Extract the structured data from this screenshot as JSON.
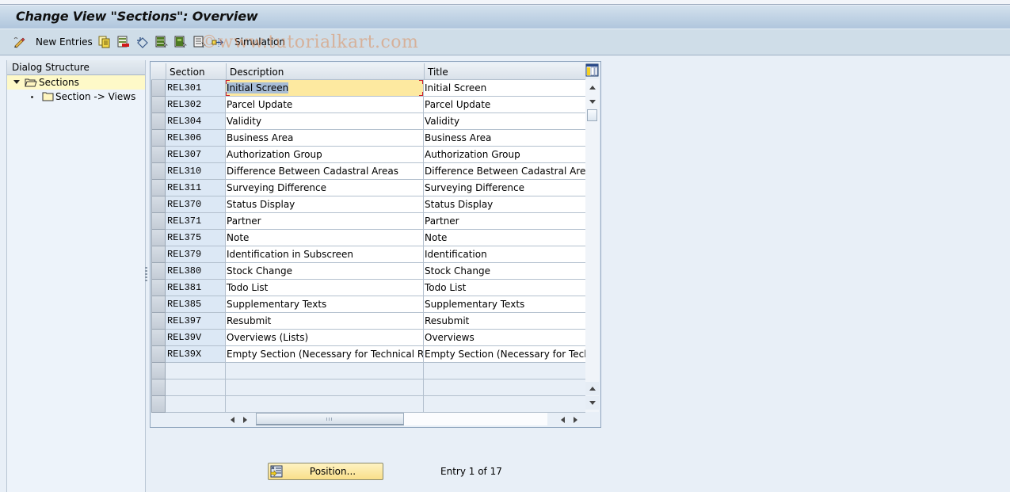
{
  "window": {
    "title": "Change View \"Sections\": Overview"
  },
  "toolbar": {
    "new_entries_label": "New Entries",
    "simulation_label": "Simulation",
    "icons": [
      "edit-pencil-icon",
      "copy-icon",
      "delete-icon",
      "undo-icon",
      "select-all-icon",
      "select-block-icon",
      "deselect-all-icon",
      "transport-icon"
    ],
    "watermark": "©www.tutorialkart.com"
  },
  "dialog_structure": {
    "header": "Dialog Structure",
    "items": [
      {
        "label": "Sections",
        "level": 0,
        "expanded": true,
        "selected": true
      },
      {
        "label": "Section -> Views",
        "level": 1,
        "expanded": false,
        "selected": false
      }
    ]
  },
  "table": {
    "columns": [
      "Section",
      "Description",
      "Title"
    ],
    "rows": [
      {
        "section": "REL301",
        "description": "Initial Screen",
        "title": "Initial Screen"
      },
      {
        "section": "REL302",
        "description": "Parcel Update",
        "title": "Parcel Update"
      },
      {
        "section": "REL304",
        "description": "Validity",
        "title": "Validity"
      },
      {
        "section": "REL306",
        "description": "Business Area",
        "title": "Business Area"
      },
      {
        "section": "REL307",
        "description": "Authorization Group",
        "title": "Authorization Group"
      },
      {
        "section": "REL310",
        "description": "Difference Between Cadastral Areas",
        "title": "Difference Between Cadastral Areas"
      },
      {
        "section": "REL311",
        "description": "Surveying Difference",
        "title": "Surveying Difference"
      },
      {
        "section": "REL370",
        "description": "Status Display",
        "title": "Status Display"
      },
      {
        "section": "REL371",
        "description": "Partner",
        "title": "Partner"
      },
      {
        "section": "REL375",
        "description": "Note",
        "title": "Note"
      },
      {
        "section": "REL379",
        "description": "Identification in Subscreen",
        "title": "Identification"
      },
      {
        "section": "REL380",
        "description": "Stock Change",
        "title": "Stock Change"
      },
      {
        "section": "REL381",
        "description": "Todo List",
        "title": "Todo List"
      },
      {
        "section": "REL385",
        "description": "Supplementary Texts",
        "title": "Supplementary Texts"
      },
      {
        "section": "REL397",
        "description": "Resubmit",
        "title": "Resubmit"
      },
      {
        "section": "REL39V",
        "description": "Overviews (Lists)",
        "title": "Overviews"
      },
      {
        "section": "REL39X",
        "description": "Empty Section (Necessary for Technical Rea…",
        "title": "Empty Section (Necessary for Techni"
      }
    ],
    "empty_rows": 3,
    "focused_cell": {
      "row": 0,
      "column": "description"
    }
  },
  "footer": {
    "position_button_label": "Position...",
    "entry_info": "Entry 1 of 17"
  }
}
